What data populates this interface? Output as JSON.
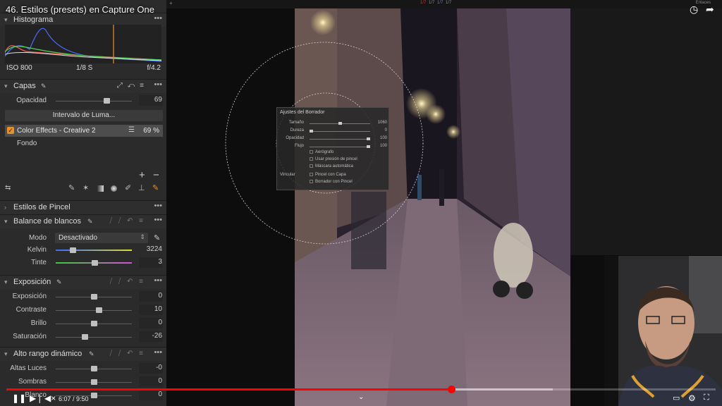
{
  "video": {
    "title": "46. Estilos (presets) en Capture One",
    "time": "6:07 / 9:50",
    "progress": 0.627,
    "buffered": 0.77,
    "top_right_label": "Enlaces",
    "counters": [
      "1/7",
      "1/7",
      "1/7",
      "1/7"
    ]
  },
  "histogram": {
    "title": "Histograma",
    "iso": "ISO 800",
    "shutter": "1/8 S",
    "aperture": "f/4.2"
  },
  "layers": {
    "title": "Capas",
    "opacity_label": "Opacidad",
    "opacity_value": "69",
    "opacity_fraction": 0.69,
    "luma_button": "Intervalo de Luma...",
    "items": [
      {
        "name": "Color Effects - Creative 2",
        "value": "69 %",
        "checked": true
      },
      {
        "name": "Fondo",
        "value": "",
        "checked": false
      }
    ],
    "add": "+",
    "remove": "−"
  },
  "brush_styles": {
    "title": "Estilos de Pincel"
  },
  "white_balance": {
    "title": "Balance de blancos",
    "mode_label": "Modo",
    "mode_value": "Desactivado",
    "kelvin_label": "Kelvin",
    "kelvin_value": "3224",
    "kelvin_fraction": 0.2,
    "tint_label": "Tinte",
    "tint_value": "3",
    "tint_fraction": 0.52
  },
  "exposure": {
    "title": "Exposición",
    "rows": [
      {
        "label": "Exposición",
        "value": "0",
        "fraction": 0.5
      },
      {
        "label": "Contraste",
        "value": "10",
        "fraction": 0.58
      },
      {
        "label": "Brillo",
        "value": "0",
        "fraction": 0.5
      },
      {
        "label": "Saturación",
        "value": "-26",
        "fraction": 0.37
      }
    ]
  },
  "hdr": {
    "title": "Alto rango dinámico",
    "rows": [
      {
        "label": "Altas Luces",
        "value": "-0",
        "fraction": 0.5
      },
      {
        "label": "Sombras",
        "value": "0",
        "fraction": 0.5
      },
      {
        "label": "Blanco",
        "value": "0",
        "fraction": 0.5
      }
    ]
  },
  "eraser": {
    "title": "Ajustes del Borrador",
    "rows": [
      {
        "label": "Tamaño",
        "value": "1060",
        "fraction": 0.5
      },
      {
        "label": "Dureza",
        "value": "0",
        "fraction": 0.0
      },
      {
        "label": "Opacidad",
        "value": "100",
        "fraction": 1.0
      },
      {
        "label": "Flujo",
        "value": "100",
        "fraction": 1.0
      }
    ],
    "options": [
      "Aerógrafo",
      "Usar presión de pincel",
      "Máscara automática"
    ],
    "link_label": "Vincular",
    "link_options": [
      "Pincel con Capa",
      "Borrador con Pincel"
    ]
  },
  "colors": {
    "accent": "#e8902a",
    "progress": "#ff0000",
    "panel": "#2b2b2b"
  }
}
